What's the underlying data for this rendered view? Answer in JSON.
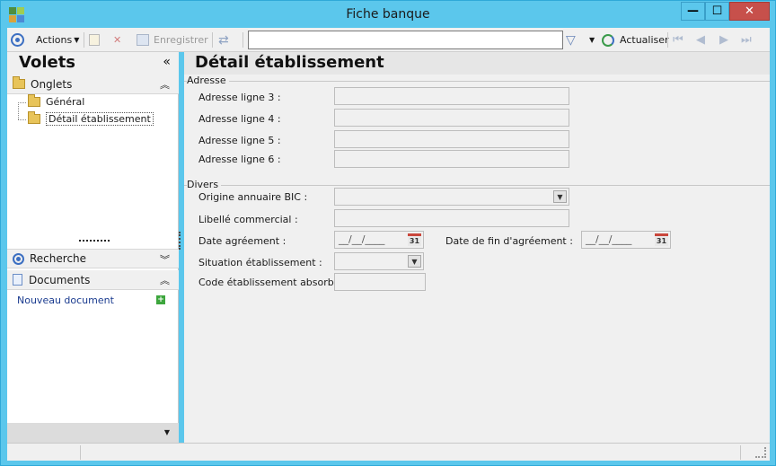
{
  "window": {
    "title": "Fiche banque",
    "minimize": "—",
    "maximize": "☐",
    "close": "✕"
  },
  "toolbar": {
    "actions_label": "Actions",
    "save_label": "Enregistrer",
    "search_value": "",
    "refresh_label": "Actualiser"
  },
  "left_panel": {
    "title": "Volets",
    "collapse_glyph": "«",
    "onglets": {
      "label": "Onglets",
      "items": [
        {
          "label": "Général"
        },
        {
          "label": "Détail établissement"
        }
      ]
    },
    "recherche": {
      "label": "Recherche"
    },
    "documents": {
      "label": "Documents",
      "new_document": "Nouveau document"
    }
  },
  "main": {
    "title": "Détail établissement",
    "adresse": {
      "title": "Adresse",
      "fields": [
        {
          "label": "Adresse ligne 3 :",
          "value": ""
        },
        {
          "label": "Adresse ligne 4 :",
          "value": ""
        },
        {
          "label": "Adresse ligne 5 :",
          "value": ""
        },
        {
          "label": "Adresse ligne 6 :",
          "value": ""
        }
      ]
    },
    "divers": {
      "title": "Divers",
      "origine_label": "Origine annuaire BIC :",
      "origine_value": "",
      "libelle_label": "Libellé commercial :",
      "libelle_value": "",
      "date_agrement_label": "Date agréement :",
      "date_agrement_value": "__/__/____",
      "date_fin_label": "Date de fin d'agréement :",
      "date_fin_value": "__/__/____",
      "calendar_glyph": "31",
      "situation_label": "Situation établissement :",
      "situation_value": "",
      "code_label": "Code établissement absorbant :",
      "code_value": ""
    }
  },
  "colors": {
    "window_frame": "#5bc7ec",
    "close_button": "#c7504b",
    "accent_blue": "#3c6fc2"
  }
}
